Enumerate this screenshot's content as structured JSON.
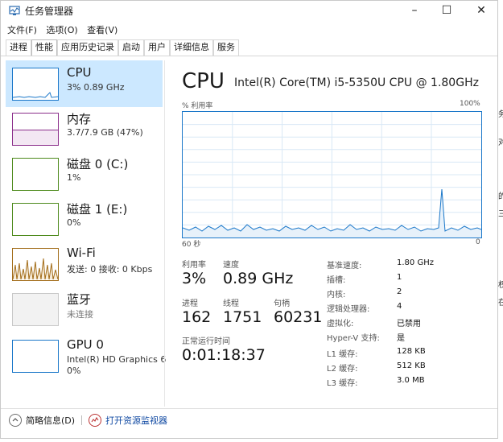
{
  "window": {
    "title": "任务管理器",
    "menu": [
      "文件(F)",
      "选项(O)",
      "查看(V)"
    ],
    "tabs": [
      "进程",
      "性能",
      "应用历史记录",
      "启动",
      "用户",
      "详细信息",
      "服务"
    ],
    "active_tab": "性能",
    "controls": {
      "minimize": "–",
      "maximize": "☐",
      "close": "✕"
    }
  },
  "sidebar": [
    {
      "name": "CPU",
      "sub": "3% 0.89 GHz",
      "sub2": "",
      "selected": true,
      "color": "#1a77c9",
      "level": 0.03
    },
    {
      "name": "内存",
      "sub": "3.7/7.9 GB (47%)",
      "sub2": "",
      "selected": false,
      "color": "#8b2e8b",
      "level": 0.47
    },
    {
      "name": "磁盘 0 (C:)",
      "sub": "1%",
      "sub2": "",
      "selected": false,
      "color": "#4d8a1c",
      "level": 0.01
    },
    {
      "name": "磁盘 1 (E:)",
      "sub": "0%",
      "sub2": "",
      "selected": false,
      "color": "#4d8a1c",
      "level": 0.0
    },
    {
      "name": "Wi-Fi",
      "sub": "发送: 0 接收: 0 Kbps",
      "sub2": "",
      "selected": false,
      "color": "#a36d1a",
      "level": 0.0
    },
    {
      "name": "蓝牙",
      "sub": "未连接",
      "sub2": "",
      "selected": false,
      "color": "#c8c8c8",
      "level": 0.0
    },
    {
      "name": "GPU 0",
      "sub": "Intel(R) HD Graphics 6",
      "sub2": "0%",
      "selected": false,
      "color": "#1a77c9",
      "level": 0.0
    }
  ],
  "main": {
    "title": "CPU",
    "model": "Intel(R) Core(TM) i5-5350U CPU @ 1.80GHz",
    "util_label": "% 利用率",
    "util_max": "100%",
    "time_left": "60 秒",
    "time_right": "0",
    "graph_color": "#1a77c9",
    "stats": {
      "util_label": "利用率",
      "util_value": "3%",
      "speed_label": "速度",
      "speed_value": "0.89 GHz",
      "proc_label": "进程",
      "proc_value": "162",
      "thread_label": "线程",
      "thread_value": "1751",
      "handle_label": "句柄",
      "handle_value": "60231",
      "uptime_label": "正常运行时间",
      "uptime_value": "0:01:18:37"
    },
    "specs": [
      {
        "k": "基准速度:",
        "v": "1.80 GHz"
      },
      {
        "k": "插槽:",
        "v": "1"
      },
      {
        "k": "内核:",
        "v": "2"
      },
      {
        "k": "逻辑处理器:",
        "v": "4"
      },
      {
        "k": "虚拟化:",
        "v": "已禁用"
      },
      {
        "k": "Hyper-V 支持:",
        "v": "是"
      },
      {
        "k": "L1 缓存:",
        "v": "128 KB"
      },
      {
        "k": "L2 缓存:",
        "v": "512 KB"
      },
      {
        "k": "L3 缓存:",
        "v": "3.0 MB"
      }
    ]
  },
  "footer": {
    "less_details": "简略信息(D)",
    "open_monitor": "打开资源监视器"
  },
  "background_stubs": [
    "务",
    "对",
    "的",
    "三",
    "权",
    "在"
  ]
}
